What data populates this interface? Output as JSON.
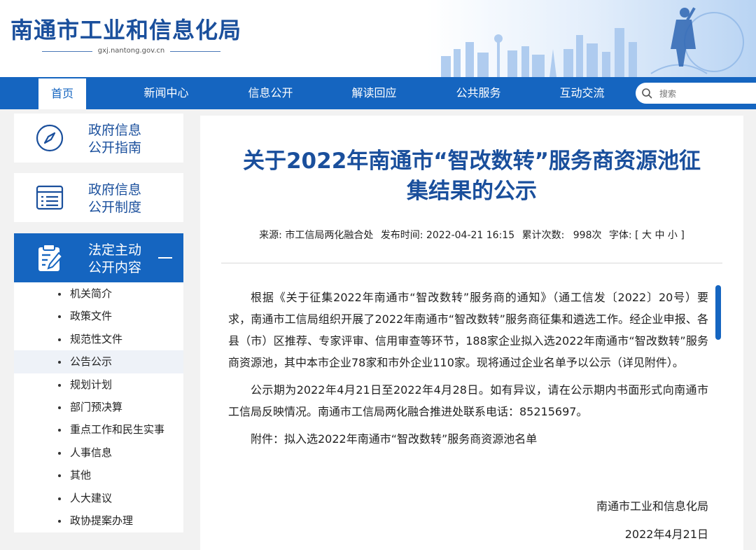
{
  "header": {
    "site_title": "南通市工业和信息化局",
    "domain": "gxj.nantong.gov.cn"
  },
  "nav": {
    "items": [
      {
        "label": "首页",
        "active": true
      },
      {
        "label": "新闻中心"
      },
      {
        "label": "信息公开"
      },
      {
        "label": "解读回应"
      },
      {
        "label": "公共服务"
      },
      {
        "label": "互动交流"
      }
    ],
    "search_placeholder": "搜索"
  },
  "sidebar": {
    "cards": [
      {
        "line1": "政府信息",
        "line2": "公开指南",
        "icon": "compass-icon"
      },
      {
        "line1": "政府信息",
        "line2": "公开制度",
        "icon": "document-list-icon"
      },
      {
        "line1": "法定主动",
        "line2": "公开内容",
        "icon": "clipboard-edit-icon",
        "active": true
      }
    ],
    "list": [
      "机关简介",
      "政策文件",
      "规范性文件",
      "公告公示",
      "规划计划",
      "部门预决算",
      "重点工作和民生实事",
      "人事信息",
      "其他",
      "人大建议",
      "政协提案办理"
    ],
    "current": "公告公示"
  },
  "article": {
    "title_line1": "关于2022年南通市“智改数转”服务商资源池征",
    "title_line2": "集结果的公示",
    "meta": {
      "source_label": "来源:",
      "source": "市工信局两化融合处",
      "time_label": "发布时间:",
      "time": "2022-04-21 16:15",
      "count_label": "累计次数:",
      "count": "998次",
      "font_label": "字体:",
      "font_options": "[ 大 中 小 ]"
    },
    "paragraphs": [
      "根据《关于征集2022年南通市“智改数转”服务商的通知》（通工信发〔2022〕20号）要求，南通市工信局组织开展了2022年南通市“智改数转”服务商征集和遴选工作。经企业申报、各县（市）区推荐、专家评审、信用审查等环节，188家企业拟入选2022年南通市“智改数转”服务商资源池，其中本市企业78家和市外企业110家。现将通过企业名单予以公示（详见附件）。",
      "公示期为2022年4月21日至2022年4月28日。如有异议，请在公示期内书面形式向南通市工信局反映情况。南通市工信局两化融合推进处联系电话：85215697。"
    ],
    "attachment": "附件：拟入选2022年南通市“智改数转”服务商资源池名单",
    "signature_org": "南通市工业和信息化局",
    "signature_date": "2022年4月21日"
  },
  "colors": {
    "brand_blue": "#1565c0",
    "title_blue": "#1a4f9c"
  }
}
